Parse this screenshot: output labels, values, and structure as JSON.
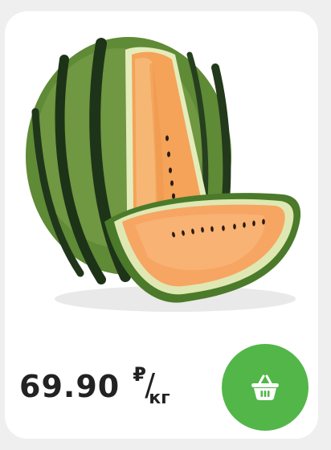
{
  "product": {
    "image_name": "orange-watermelon-product-image"
  },
  "price": {
    "value": "69.90",
    "currency_symbol": "₽",
    "unit": "кг"
  },
  "cart_button": {
    "icon": "basket-icon"
  },
  "colors": {
    "card_background": "#ffffff",
    "page_background": "#efefef",
    "accent_green": "#53b649",
    "text_dark": "#222222"
  }
}
